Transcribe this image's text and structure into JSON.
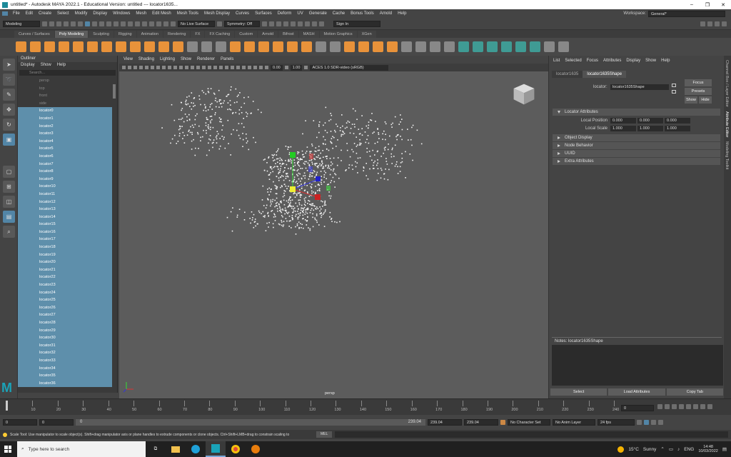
{
  "window": {
    "title": "untitled* - Autodesk MAYA 2022.1 - Educational Version: untitled  ---  locator1635..."
  },
  "menubar": {
    "items": [
      "File",
      "Edit",
      "Create",
      "Select",
      "Modify",
      "Display",
      "Windows",
      "Mesh",
      "Edit Mesh",
      "Mesh Tools",
      "Mesh Display",
      "Curves",
      "Surfaces",
      "Deform",
      "UV",
      "Generate",
      "Cache",
      "Bonus Tools",
      "Arnold",
      "Help"
    ],
    "workspace_label": "Workspace:",
    "workspace_value": "General*"
  },
  "statusline": {
    "mode": "Modeling",
    "live_surface": "No Live Surface",
    "symmetry": "Symmetry: Off",
    "sign_in": "Sign In"
  },
  "shelf": {
    "tabs": [
      "Curves / Surfaces",
      "Poly Modeling",
      "Sculpting",
      "Rigging",
      "Animation",
      "Rendering",
      "FX",
      "FX Caching",
      "Custom",
      "Arnold",
      "Bifrost",
      "MASH",
      "Motion Graphics",
      "XGen"
    ],
    "active_tab": "Poly Modeling"
  },
  "outliner": {
    "title": "Outliner",
    "menu": [
      "Display",
      "Show",
      "Help"
    ],
    "search_placeholder": "Search...",
    "cameras": [
      "persp",
      "top",
      "front",
      "side"
    ],
    "locators": [
      "locator0",
      "locator1",
      "locator2",
      "locator3",
      "locator4",
      "locator5",
      "locator6",
      "locator7",
      "locator8",
      "locator9",
      "locator10",
      "locator11",
      "locator12",
      "locator13",
      "locator14",
      "locator15",
      "locator16",
      "locator17",
      "locator18",
      "locator19",
      "locator20",
      "locator21",
      "locator22",
      "locator23",
      "locator24",
      "locator25",
      "locator26",
      "locator27",
      "locator28",
      "locator29",
      "locator30",
      "locator31",
      "locator32",
      "locator33",
      "locator34",
      "locator35",
      "locator36"
    ]
  },
  "viewport": {
    "menu": [
      "View",
      "Shading",
      "Lighting",
      "Show",
      "Renderer",
      "Panels"
    ],
    "exposure": "0.00",
    "gamma": "1.00",
    "color_space": "ACES 1.0 SDR-video (sRGB)",
    "camera_label": "persp"
  },
  "attribute_editor": {
    "menu": [
      "List",
      "Selected",
      "Focus",
      "Attributes",
      "Display",
      "Show",
      "Help"
    ],
    "tabs": [
      "locator1635",
      "locator1635Shape"
    ],
    "active_tab": "locator1635Shape",
    "node_label": "locator:",
    "node_value": "locator1635Shape",
    "buttons": [
      "Focus",
      "Presets",
      "Show",
      "Hide"
    ],
    "sections": {
      "locator_attributes": "Locator Attributes",
      "local_position_label": "Local Position",
      "local_position": [
        "0.000",
        "0.000",
        "0.000"
      ],
      "local_scale_label": "Local Scale",
      "local_scale": [
        "1.000",
        "1.000",
        "1.000"
      ],
      "collapsed": [
        "Object Display",
        "Node Behavior",
        "UUID",
        "Extra Attributes"
      ]
    },
    "notes_label": "Notes:  locator1635Shape",
    "bottom_buttons": [
      "Select",
      "Load Attributes",
      "Copy Tab"
    ]
  },
  "side_tabs": [
    "Channel Box / Layer Editor",
    "Attribute Editor",
    "Modeling Toolkit"
  ],
  "timeline": {
    "ticks": [
      "0",
      "10",
      "20",
      "30",
      "40",
      "50",
      "60",
      "70",
      "80",
      "90",
      "100",
      "110",
      "120",
      "130",
      "140",
      "150",
      "160",
      "170",
      "180",
      "190",
      "200",
      "210",
      "220",
      "230",
      "240"
    ],
    "current_frame": "0"
  },
  "range": {
    "start": "0",
    "anim_start": "0",
    "slider_start": "0",
    "slider_end": "239.04",
    "anim_end": "239.04",
    "end": "239.04",
    "character_set": "No Character Set",
    "anim_layer": "No Anim Layer",
    "fps": "24 fps"
  },
  "helpline": {
    "text": "Scale Tool: Use manipulator to scale object(s). Shift+drag manipulator axis or plane handles to extrude components or clone objects. Ctrl+Shift+LMB+drag to constrain scaling to",
    "mel": "MEL"
  },
  "taskbar": {
    "search_placeholder": "Type here to search",
    "weather_temp": "15°C",
    "weather_text": "Sunny",
    "lang": "ENG",
    "time": "14:48",
    "date": "10/03/2022"
  }
}
